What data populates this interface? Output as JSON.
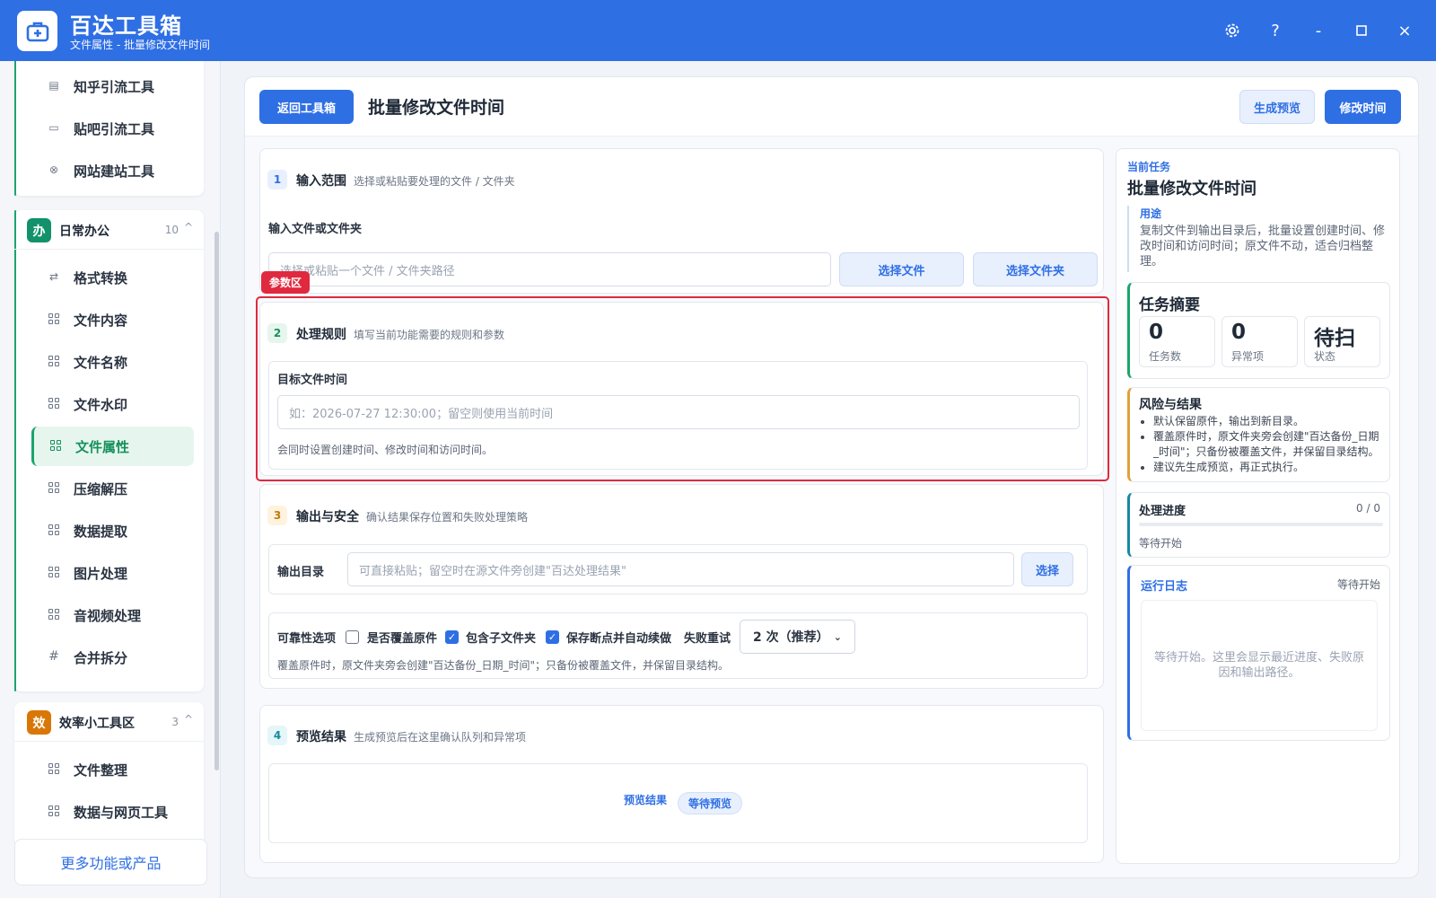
{
  "app": {
    "title": "百达工具箱",
    "subtitle": "文件属性 - 批量修改文件时间",
    "settings_icon": "gear-icon",
    "help_label": "?",
    "minimize_label": "-",
    "close_label": "×"
  },
  "sidebar": {
    "top_items": [
      {
        "label": "知乎引流工具",
        "icon": "page-icon"
      },
      {
        "label": "贴吧引流工具",
        "icon": "message-icon"
      },
      {
        "label": "网站建站工具",
        "icon": "globe-icon"
      }
    ],
    "groups": [
      {
        "badge": "办",
        "badge_color": "#12916a",
        "title": "日常办公",
        "count": "10",
        "caret": "^",
        "items": [
          {
            "label": "格式转换",
            "icon": "swap-icon"
          },
          {
            "label": "文件内容",
            "icon": "grid-icon"
          },
          {
            "label": "文件名称",
            "icon": "grid-icon"
          },
          {
            "label": "文件水印",
            "icon": "grid-icon"
          },
          {
            "label": "文件属性",
            "icon": "grid-icon",
            "active": true
          },
          {
            "label": "压缩解压",
            "icon": "grid-icon"
          },
          {
            "label": "数据提取",
            "icon": "grid-icon"
          },
          {
            "label": "图片处理",
            "icon": "grid-icon"
          },
          {
            "label": "音视频处理",
            "icon": "grid-icon"
          },
          {
            "label": "合并拆分",
            "icon": "hash-icon"
          }
        ]
      },
      {
        "badge": "效",
        "badge_color": "#d97706",
        "title": "效率小工具区",
        "count": "3",
        "caret": "^",
        "items": [
          {
            "label": "文件整理",
            "icon": "grid-icon"
          },
          {
            "label": "数据与网页工具",
            "icon": "grid-icon"
          }
        ]
      }
    ],
    "more_label": "更多功能或产品",
    "accent_color": "#1aa56b"
  },
  "toolbar": {
    "back_label": "返回工具箱",
    "page_title": "批量修改文件时间",
    "preview_label": "生成预览",
    "run_label": "修改时间"
  },
  "step1": {
    "num": "1",
    "title": "输入范围",
    "desc": "选择或粘贴要处理的文件 / 文件夹",
    "field_label": "输入文件或文件夹",
    "placeholder": "选择或粘贴一个文件 / 文件夹路径",
    "choose_file": "选择文件",
    "choose_folder": "选择文件夹"
  },
  "param_tag": "参数区",
  "step2": {
    "num": "2",
    "title": "处理规则",
    "desc": "填写当前功能需要的规则和参数",
    "field_label": "目标文件时间",
    "placeholder": "如：2026-07-27 12:30:00；留空则使用当前时间",
    "hint": "会同时设置创建时间、修改时间和访问时间。"
  },
  "step3": {
    "num": "3",
    "title": "输出与安全",
    "desc": "确认结果保存位置和失败处理策略",
    "output_label": "输出目录",
    "output_placeholder": "可直接粘贴；留空时在源文件旁创建\"百达处理结果\"",
    "choose_label": "选择",
    "reliability_label": "可靠性选项",
    "overwrite_label": "是否覆盖原件",
    "overwrite_checked": false,
    "subfolder_label": "包含子文件夹",
    "subfolder_checked": true,
    "resume_label": "保存断点并自动续做",
    "resume_checked": true,
    "retry_label": "失败重试",
    "retry_value": "2 次（推荐）",
    "hint": "覆盖原件时，原文件夹旁会创建\"百达备份_日期_时间\"；只备份被覆盖文件，并保留目录结构。"
  },
  "step4": {
    "num": "4",
    "title": "预览结果",
    "desc": "生成预览后在这里确认队列和异常项",
    "result_label": "预览结果",
    "status_badge": "等待预览"
  },
  "right": {
    "kicker": "当前任务",
    "task_title": "批量修改文件时间",
    "usage_label": "用途",
    "usage_text": "复制文件到输出目录后，批量设置创建时间、修改时间和访问时间；原文件不动，适合归档整理。",
    "summary_title": "任务摘要",
    "stats": [
      {
        "value": "0",
        "label": "任务数"
      },
      {
        "value": "0",
        "label": "异常项"
      },
      {
        "value": "待扫",
        "label": "状态"
      }
    ],
    "risk_title": "风险与结果",
    "risk_items": [
      "默认保留原件，输出到新目录。",
      "覆盖原件时，原文件夹旁会创建\"百达备份_日期_时间\"；只备份被覆盖文件，并保留目录结构。",
      "建议先生成预览，再正式执行。"
    ],
    "progress_title": "处理进度",
    "progress_count": "0 / 0",
    "progress_value": 0,
    "progress_status": "等待开始",
    "log_title": "运行日志",
    "log_status": "等待开始",
    "log_text": "等待开始。这里会显示最近进度、失败原因和输出路径。"
  },
  "colors": {
    "brand": "#2f6fe4",
    "accent_green": "#1aa56b",
    "warning": "#e0a13a",
    "danger": "#e0293f"
  }
}
